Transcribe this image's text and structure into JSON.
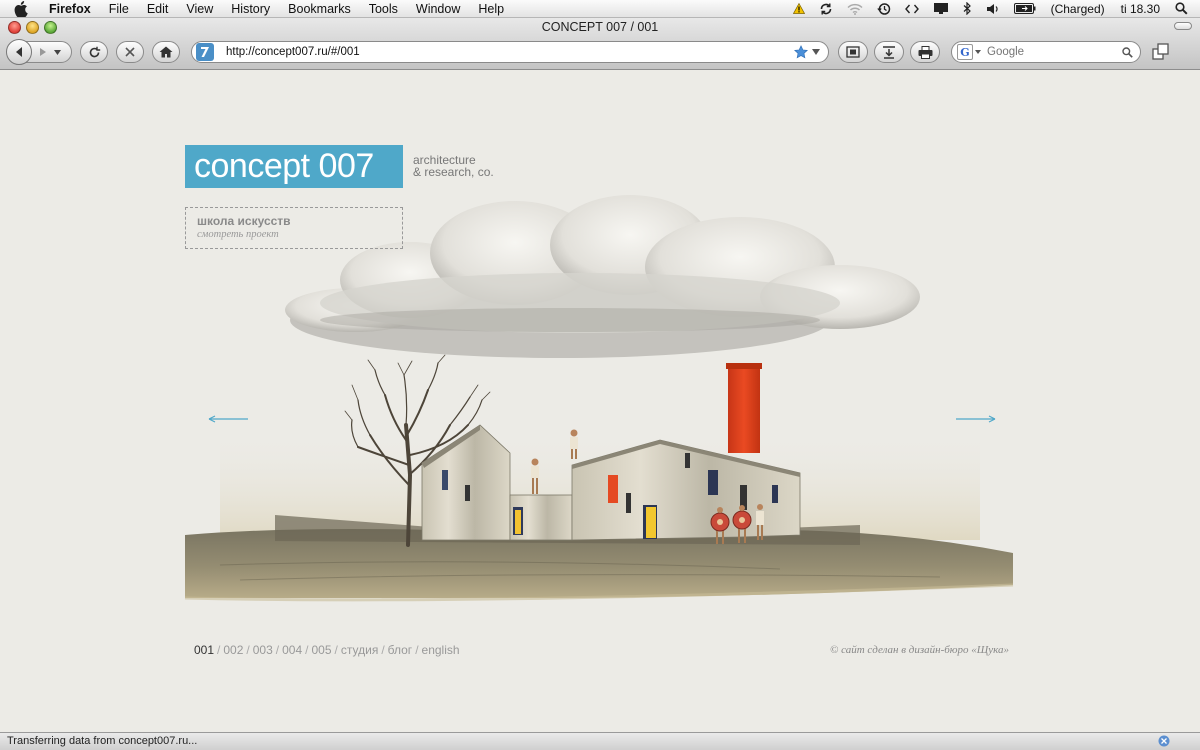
{
  "menubar": {
    "app_name": "Firefox",
    "menus": [
      "File",
      "Edit",
      "View",
      "History",
      "Bookmarks",
      "Tools",
      "Window",
      "Help"
    ],
    "battery_text": "(Charged)",
    "clock": "ti 18.30"
  },
  "window": {
    "title": "CONCEPT 007 / 001"
  },
  "toolbar": {
    "url": "http://concept007.ru/#/001",
    "search_placeholder": "Google"
  },
  "page": {
    "logo_text": "concept 007",
    "tagline_line1": "architecture",
    "tagline_line2": "& research, co.",
    "project_title": "школа искусств",
    "project_link": "смотреть проект",
    "nav": [
      {
        "label": "001",
        "active": true
      },
      {
        "label": "002"
      },
      {
        "label": "003"
      },
      {
        "label": "004"
      },
      {
        "label": "005"
      },
      {
        "label": "студия"
      },
      {
        "label": "блог"
      },
      {
        "label": "english"
      }
    ],
    "separator": "/",
    "credit": "© сайт сделан в дизайн-бюро «Щука»"
  },
  "statusbar": {
    "text": "Transferring data from concept007.ru..."
  },
  "colors": {
    "logo_bg": "#4fa8c9",
    "page_bg": "#ecebe6",
    "chimney": "#e0431f",
    "arrow": "#4fa8c9"
  }
}
